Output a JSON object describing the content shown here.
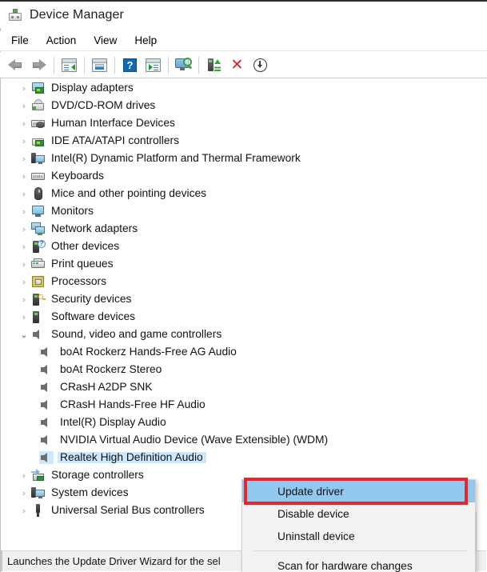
{
  "window": {
    "title": "Device Manager",
    "title_icon": "device-manager-icon"
  },
  "menubar": {
    "items": [
      {
        "label": "File"
      },
      {
        "label": "Action"
      },
      {
        "label": "View"
      },
      {
        "label": "Help"
      }
    ]
  },
  "toolbar": {
    "buttons": [
      {
        "name": "back-arrow-icon",
        "tooltip": "Back"
      },
      {
        "name": "forward-arrow-icon",
        "tooltip": "Forward"
      },
      {
        "name": "show-hide-console-tree-icon",
        "tooltip": "Show/Hide Console Tree"
      },
      {
        "name": "properties-icon",
        "tooltip": "Properties"
      },
      {
        "name": "help-icon",
        "tooltip": "Help"
      },
      {
        "name": "show-hide-action-pane-icon",
        "tooltip": "Show/Hide Action Pane"
      },
      {
        "name": "scan-for-hardware-changes-icon",
        "tooltip": "Scan for hardware changes"
      },
      {
        "name": "update-driver-icon",
        "tooltip": "Update driver"
      },
      {
        "name": "uninstall-device-icon",
        "tooltip": "Uninstall device"
      },
      {
        "name": "disable-device-icon",
        "tooltip": "Disable device"
      }
    ],
    "help_glyph": "?",
    "x_glyph": "✕"
  },
  "tree": {
    "chevron_collapsed": "›",
    "chevron_expanded": "⌄",
    "items": [
      {
        "label": "Display adapters",
        "level": 1,
        "icon": "display-adapter-icon",
        "state": "collapsed",
        "selected": false
      },
      {
        "label": "DVD/CD-ROM drives",
        "level": 1,
        "icon": "dvd-drive-icon",
        "state": "collapsed",
        "selected": false
      },
      {
        "label": "Human Interface Devices",
        "level": 1,
        "icon": "human-interface-icon",
        "state": "collapsed",
        "selected": false
      },
      {
        "label": "IDE ATA/ATAPI controllers",
        "level": 1,
        "icon": "ide-controller-icon",
        "state": "collapsed",
        "selected": false
      },
      {
        "label": "Intel(R) Dynamic Platform and Thermal Framework",
        "level": 1,
        "icon": "system-device-icon",
        "state": "collapsed",
        "selected": false
      },
      {
        "label": "Keyboards",
        "level": 1,
        "icon": "keyboard-icon",
        "state": "collapsed",
        "selected": false
      },
      {
        "label": "Mice and other pointing devices",
        "level": 1,
        "icon": "mouse-icon",
        "state": "collapsed",
        "selected": false
      },
      {
        "label": "Monitors",
        "level": 1,
        "icon": "monitor-icon",
        "state": "collapsed",
        "selected": false
      },
      {
        "label": "Network adapters",
        "level": 1,
        "icon": "network-adapter-icon",
        "state": "collapsed",
        "selected": false
      },
      {
        "label": "Other devices",
        "level": 1,
        "icon": "other-device-icon",
        "state": "collapsed",
        "selected": false
      },
      {
        "label": "Print queues",
        "level": 1,
        "icon": "printer-icon",
        "state": "collapsed",
        "selected": false
      },
      {
        "label": "Processors",
        "level": 1,
        "icon": "processor-icon",
        "state": "collapsed",
        "selected": false
      },
      {
        "label": "Security devices",
        "level": 1,
        "icon": "security-device-icon",
        "state": "collapsed",
        "selected": false
      },
      {
        "label": "Software devices",
        "level": 1,
        "icon": "software-device-icon",
        "state": "collapsed",
        "selected": false
      },
      {
        "label": "Sound, video and game controllers",
        "level": 1,
        "icon": "sound-controller-icon",
        "state": "expanded",
        "selected": false
      },
      {
        "label": "boAt Rockerz Hands-Free AG Audio",
        "level": 2,
        "icon": "audio-device-icon",
        "state": "leaf",
        "selected": false
      },
      {
        "label": "boAt Rockerz Stereo",
        "level": 2,
        "icon": "audio-device-icon",
        "state": "leaf",
        "selected": false
      },
      {
        "label": "CRasH A2DP SNK",
        "level": 2,
        "icon": "audio-device-icon",
        "state": "leaf",
        "selected": false
      },
      {
        "label": "CRasH Hands-Free HF Audio",
        "level": 2,
        "icon": "audio-device-icon",
        "state": "leaf",
        "selected": false
      },
      {
        "label": "Intel(R) Display Audio",
        "level": 2,
        "icon": "audio-device-icon",
        "state": "leaf",
        "selected": false
      },
      {
        "label": "NVIDIA Virtual Audio Device (Wave Extensible) (WDM)",
        "level": 2,
        "icon": "audio-device-icon",
        "state": "leaf",
        "selected": false
      },
      {
        "label": "Realtek High Definition Audio",
        "level": 2,
        "icon": "audio-device-icon",
        "state": "leaf",
        "selected": true
      },
      {
        "label": "Storage controllers",
        "level": 1,
        "icon": "storage-controller-icon",
        "state": "collapsed",
        "selected": false
      },
      {
        "label": "System devices",
        "level": 1,
        "icon": "system-device-icon",
        "state": "collapsed",
        "selected": false
      },
      {
        "label": "Universal Serial Bus controllers",
        "level": 1,
        "icon": "usb-controller-icon",
        "state": "collapsed",
        "selected": false
      }
    ]
  },
  "context_menu": {
    "items": [
      {
        "label": "Update driver",
        "highlighted": true,
        "separator_after": false
      },
      {
        "label": "Disable device",
        "highlighted": false,
        "separator_after": false
      },
      {
        "label": "Uninstall device",
        "highlighted": false,
        "separator_after": true
      },
      {
        "label": "Scan for hardware changes",
        "highlighted": false,
        "separator_after": false
      }
    ]
  },
  "annotation": {
    "highlight_color": "#e8252a",
    "target": "Update driver"
  },
  "statusbar": {
    "text": "Launches the Update Driver Wizard for the sel"
  },
  "colors": {
    "selection": "#cce8ff",
    "menu_highlight": "#90c8f0",
    "annotation_red": "#e8252a",
    "window_bg": "#ffffff",
    "statusbar_bg": "#f0f0f0"
  }
}
